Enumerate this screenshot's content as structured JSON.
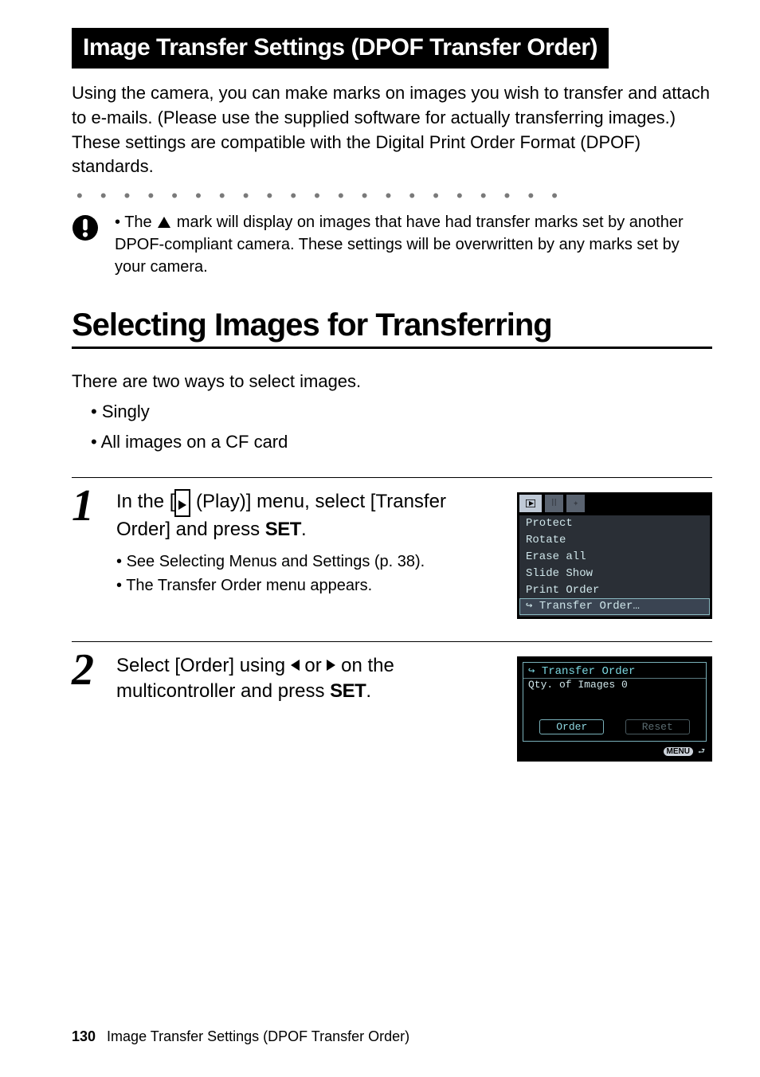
{
  "header": {
    "title": "Image Transfer Settings (DPOF Transfer Order)",
    "intro": "Using the camera, you can make marks on images you wish to transfer and attach to e-mails. (Please use the supplied software for actually transferring images.) These settings are compatible with the Digital Print Order Format (DPOF) standards."
  },
  "warning": {
    "bullet_pre": "The ",
    "bullet_post": " mark will display on images that have had transfer marks set by another DPOF-compliant camera. These settings will be overwritten by any marks set by your camera."
  },
  "section": {
    "title": "Selecting Images for Transferring",
    "intro": "There are two ways to select images.",
    "list": {
      "item1": "Singly",
      "item2": "All images on a CF card"
    }
  },
  "steps": [
    {
      "num": "1",
      "head_pre": "In the [",
      "head_mid": " (Play)] menu, select [Transfer Order] and press ",
      "head_post": ".",
      "set_label": "SET",
      "bullets": {
        "b1": "See Selecting Menus and Settings (p. 38).",
        "b2": "The Transfer Order menu appears."
      },
      "lcd": {
        "menu": {
          "i0": "Protect",
          "i1": "Rotate",
          "i2": "Erase all",
          "i3": "Slide Show",
          "i4": "Print Order",
          "i5": "Transfer Order…"
        }
      }
    },
    {
      "num": "2",
      "head_pre": "Select [Order] using ",
      "head_mid": " or ",
      "head_post": " on the multicontroller and press ",
      "head_end": ".",
      "set_label": "SET",
      "lcd": {
        "title": "Transfer Order",
        "line": "Qty. of Images 0",
        "btn_order": "Order",
        "btn_reset": "Reset",
        "menu_tag": "MENU"
      }
    }
  ],
  "footer": {
    "page": "130",
    "title": "Image Transfer Settings (DPOF Transfer Order)"
  }
}
